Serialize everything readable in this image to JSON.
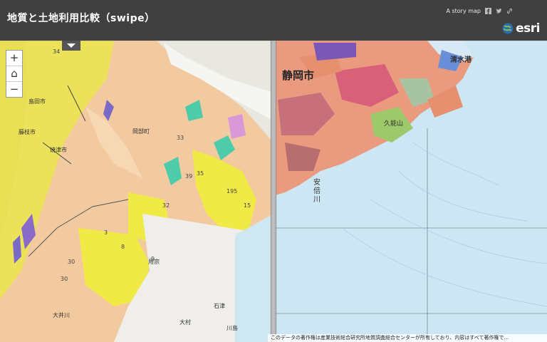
{
  "header": {
    "title": "地質と土地利用比較（swipe）",
    "story_label": "A story map",
    "brand": "esri"
  },
  "zoom": {
    "in_label": "+",
    "home_label": "⌂",
    "out_label": "−"
  },
  "labels": {
    "shizuoka_city": "静岡市",
    "shimizu_port": "清水港",
    "yasuraka": "安",
    "yasuraka2": "倍",
    "yasuraka3": "川",
    "kunosan": "久能山",
    "fujieda": "藤枝市",
    "yaizu": "焼津市",
    "shimada": "島田市",
    "okabe": "岡部町",
    "mochimune": "用宗",
    "oisegawa": "大井川",
    "ishizu": "石津",
    "omura": "大村",
    "kawashima": "川島"
  },
  "map_numbers": [
    "34",
    "30",
    "30",
    "33",
    "35",
    "39",
    "32",
    "195",
    "15",
    "8",
    "9",
    "3"
  ],
  "attribution": "このデータの著作権は産業技術総合研究所地質調査総合センターが所有しており、内容はすべて著作権で..."
}
